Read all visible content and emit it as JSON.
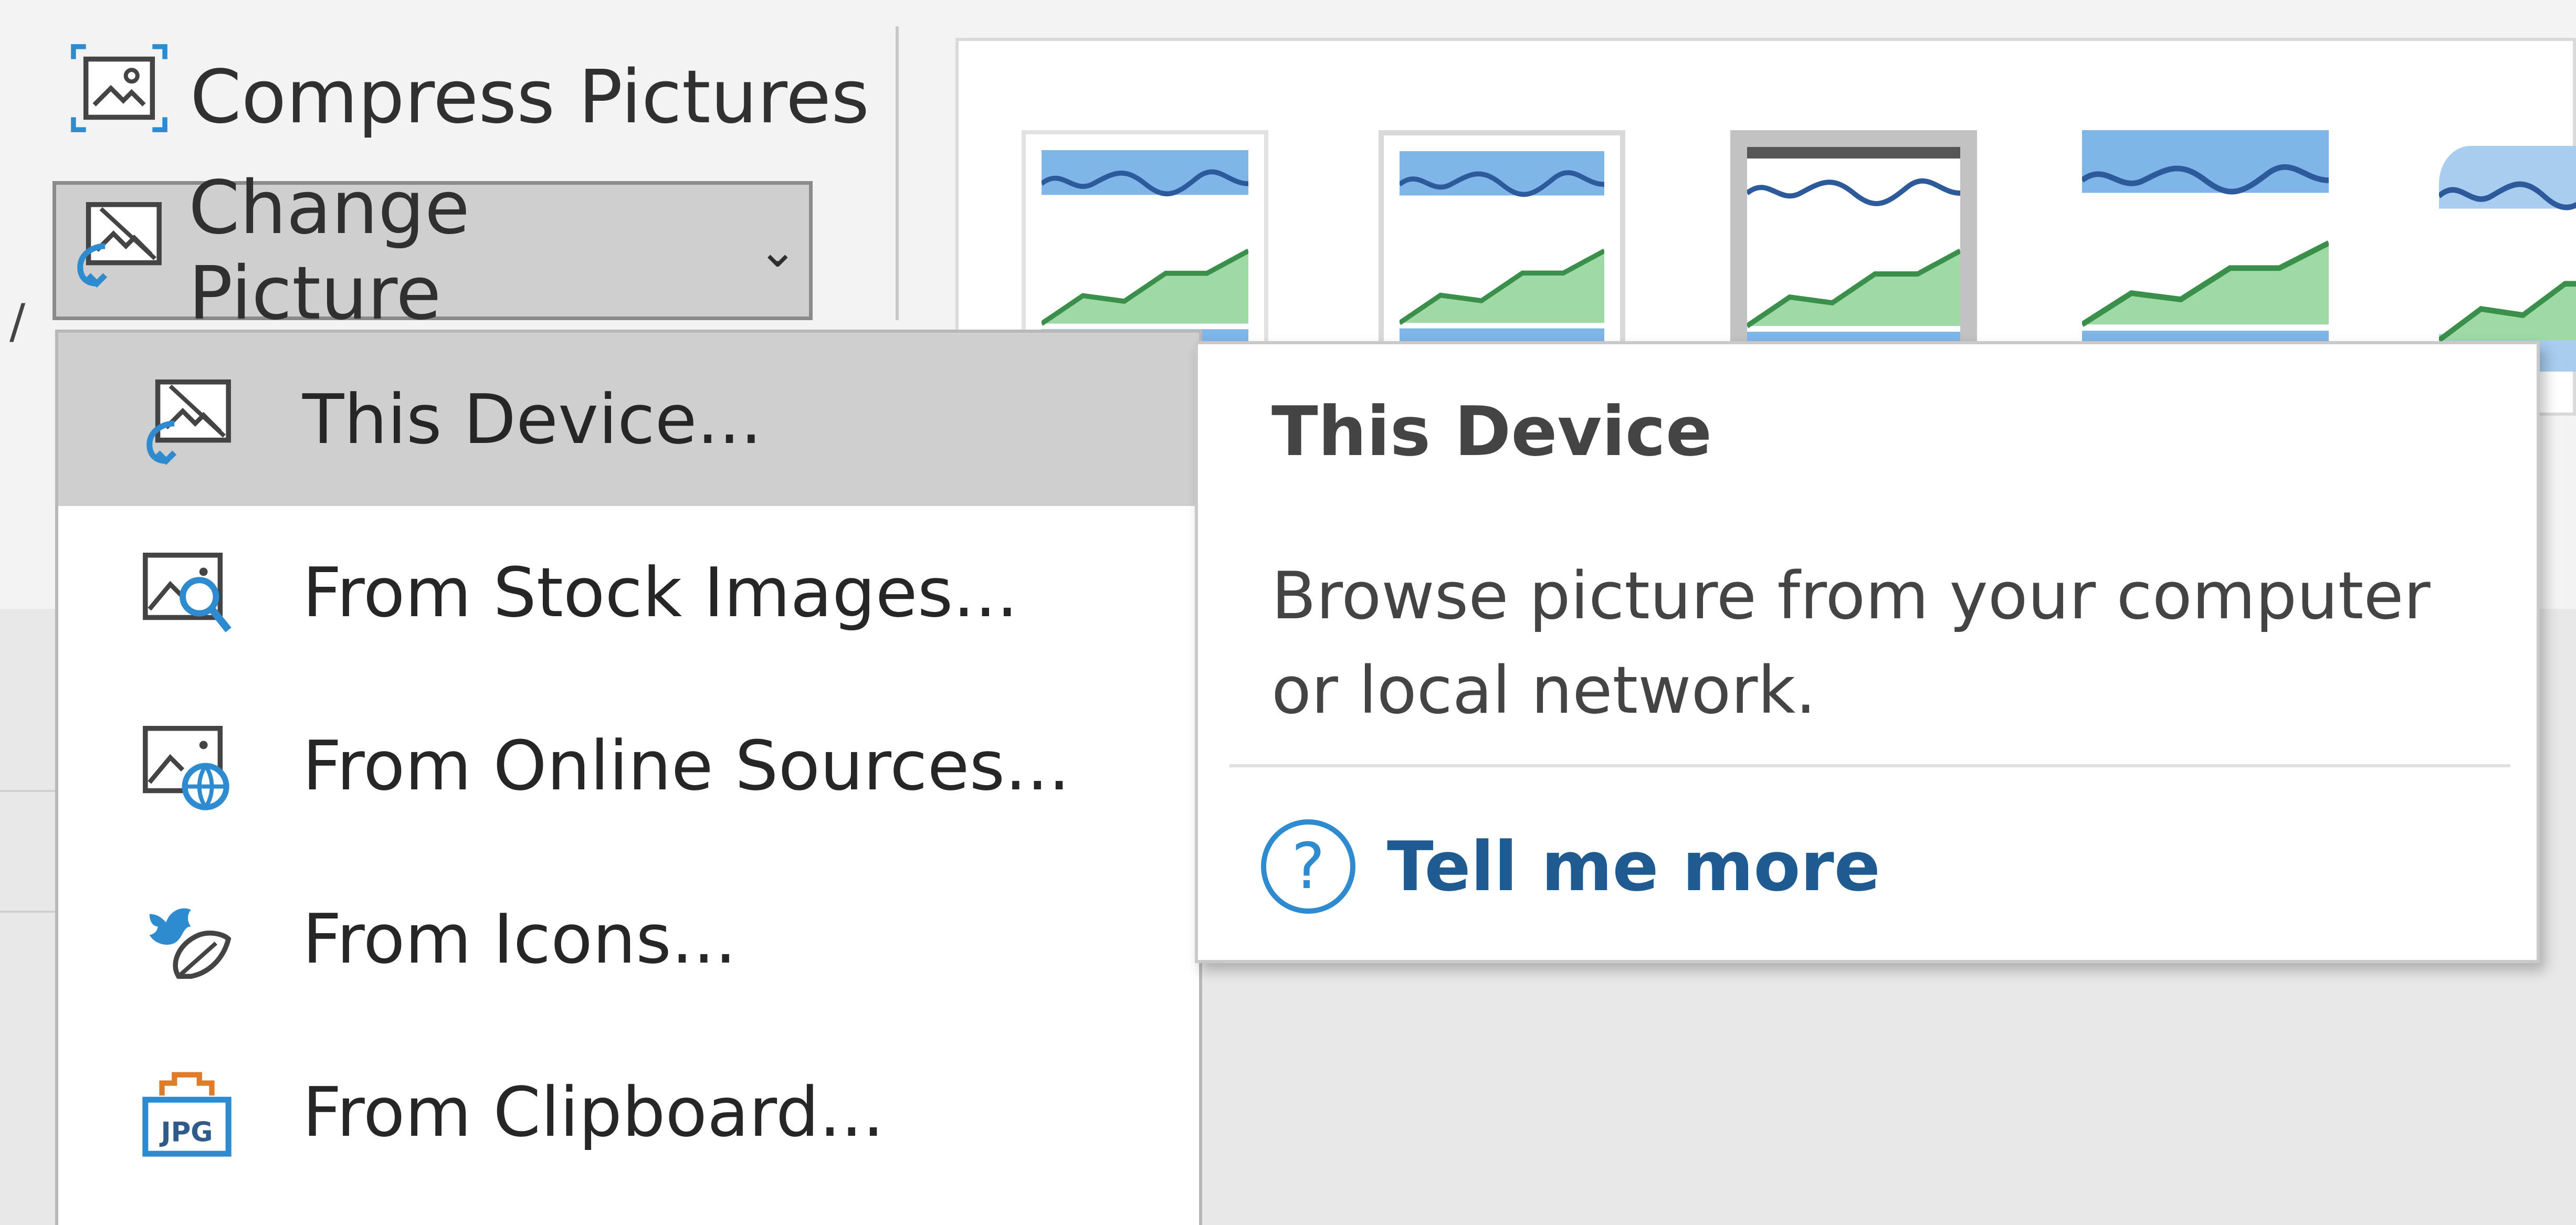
{
  "ribbon": {
    "compress_label": "Compress Pictures",
    "change_label": "Change Picture",
    "change_chevron": "⌄"
  },
  "menu": {
    "items": [
      {
        "label": "This Device...",
        "icon": "device-picture-icon"
      },
      {
        "label": "From Stock Images...",
        "icon": "stock-images-icon"
      },
      {
        "label": "From Online Sources...",
        "icon": "online-sources-icon"
      },
      {
        "label": "From Icons...",
        "icon": "icons-icon"
      },
      {
        "label": "From Clipboard...",
        "icon": "clipboard-jpg-icon",
        "badge": "JPG"
      }
    ]
  },
  "tooltip": {
    "title": "This Device",
    "description": "Browse picture from your computer or local network.",
    "help_label": "Tell me more",
    "help_glyph": "?"
  },
  "colors": {
    "sky": "#7fb5e8",
    "hill": "#9fd9a6",
    "accent_blue": "#2f8bd0",
    "hover": "#cfcfcf"
  }
}
